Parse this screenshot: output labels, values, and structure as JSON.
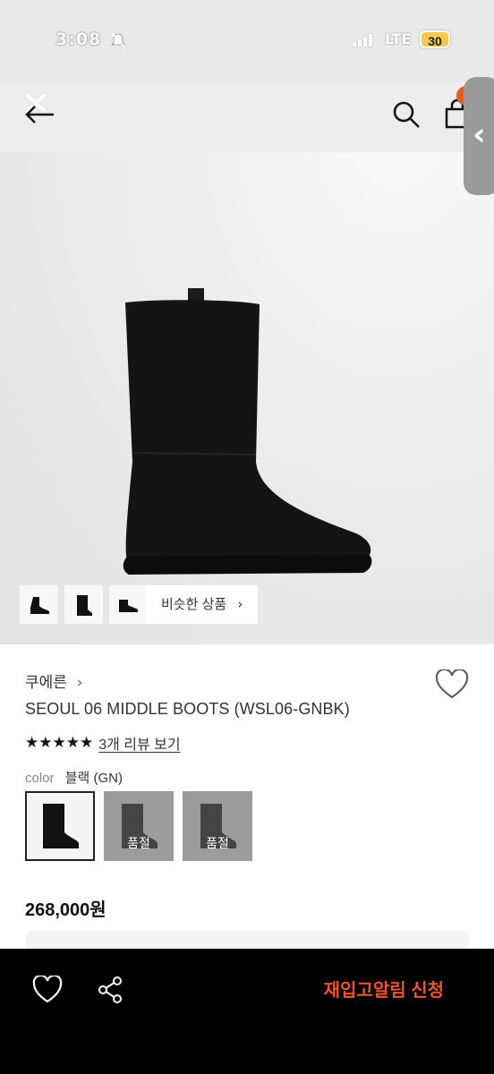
{
  "status_bar": {
    "time": "3:08",
    "network": "LTE",
    "battery": "30"
  },
  "nav": {
    "back_icon": "back-arrow-icon",
    "search_icon": "search-icon",
    "bag_icon": "shopping-bag-icon"
  },
  "gallery": {
    "similar_label": "비슷한 상품",
    "similar_chevron": "›"
  },
  "product": {
    "brand": "쿠에른",
    "brand_chevron": "›",
    "name": "SEOUL 06 MIDDLE BOOTS (WSL06-GNBK)",
    "stars": "★★★★★",
    "rating": 5,
    "review_link": "3개 리뷰 보기",
    "color_label": "color",
    "color_value": "블랙 (GN)",
    "swatches": [
      {
        "state": "selected"
      },
      {
        "state": "soldout",
        "label": "품절"
      },
      {
        "state": "soldout",
        "label": "품절"
      }
    ],
    "price": "268,000원"
  },
  "bottom_bar": {
    "restock_label": "재입고알림 신청"
  },
  "colors": {
    "accent": "#f0522b",
    "badge": "#e85b1b",
    "soldout_bg": "#9c9c9c"
  }
}
